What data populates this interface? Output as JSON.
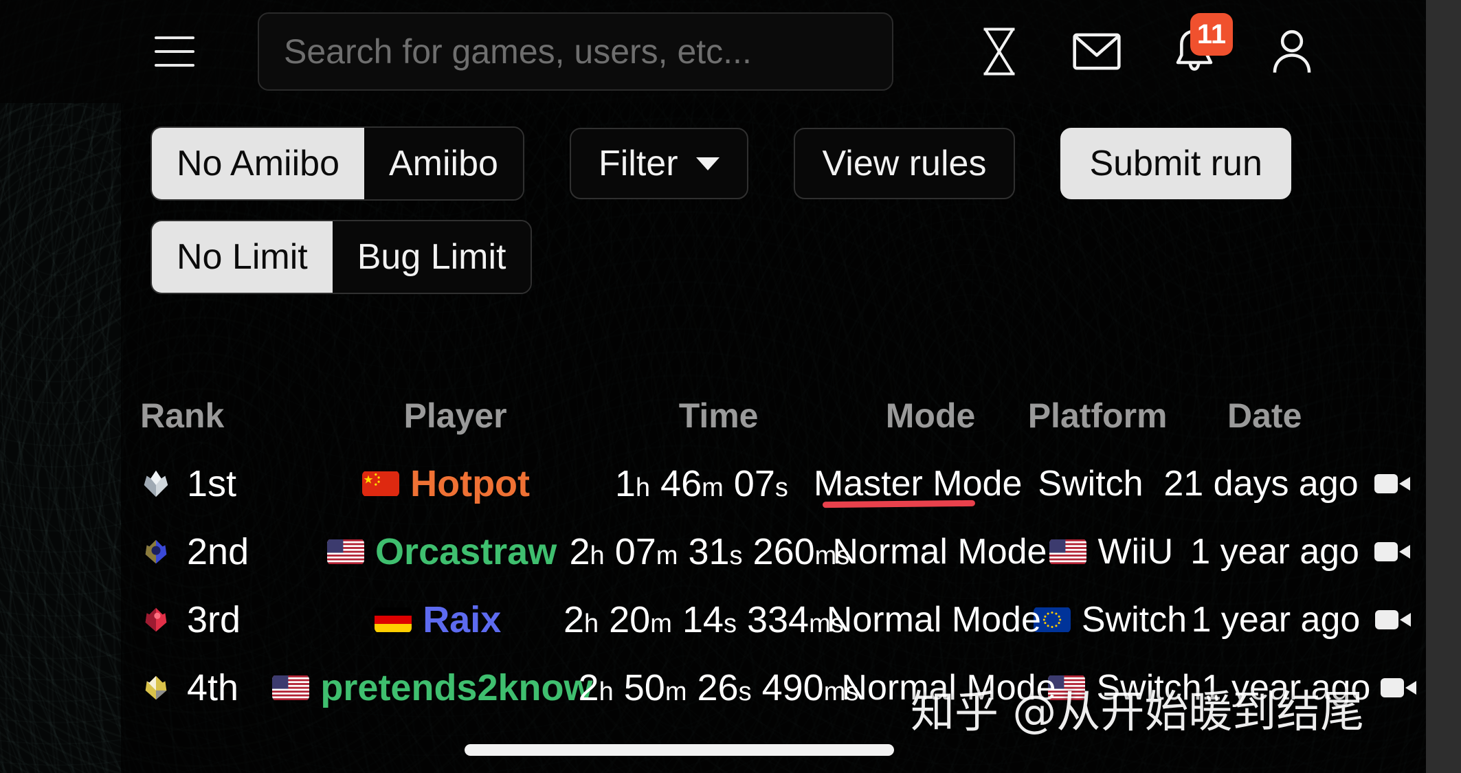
{
  "header": {
    "menu_icon": "hamburger-icon",
    "search": {
      "placeholder": "Search for games, users, etc...",
      "value": ""
    },
    "icons": [
      {
        "name": "hourglass-icon",
        "label": "Pending runs"
      },
      {
        "name": "envelope-icon",
        "label": "Messages"
      },
      {
        "name": "bell-icon",
        "label": "Notifications",
        "badge": "11"
      },
      {
        "name": "user-icon",
        "label": "Account"
      }
    ],
    "badge_color": "#f0512e"
  },
  "toolbar": {
    "amiibo_segment": {
      "options": [
        "No Amiibo",
        "Amiibo"
      ],
      "selected": "No Amiibo"
    },
    "limit_segment": {
      "options": [
        "No Limit",
        "Bug Limit"
      ],
      "selected": "No Limit"
    },
    "filter_label": "Filter",
    "view_rules_label": "View rules",
    "submit_run_label": "Submit run"
  },
  "leaderboard": {
    "columns": [
      "Rank",
      "Player",
      "Time",
      "Mode",
      "Platform",
      "Date"
    ],
    "rows": [
      {
        "rank": "1st",
        "gem": "silver-gem-icon",
        "gem_color": "#cfd6dc",
        "player": "Hotpot",
        "player_color": "#ef7134",
        "flag": "cn",
        "time": {
          "h": "1",
          "m": "46",
          "s": "07",
          "ms": ""
        },
        "time_text": "1h 46m 07s",
        "mode": "Master Mode",
        "platform": "Switch",
        "platform_flag": "",
        "date": "21 days ago",
        "video": "video-icon",
        "annotated": true
      },
      {
        "rank": "2nd",
        "gem": "blue-gem-icon",
        "gem_color": "#3a49d8",
        "player": "Orcastraw",
        "player_color": "#3fbf6f",
        "flag": "us",
        "time": {
          "h": "2",
          "m": "07",
          "s": "31",
          "ms": "260"
        },
        "time_text": "2h 07m 31s 260ms",
        "mode": "Normal Mode",
        "platform": "WiiU",
        "platform_flag": "us",
        "date": "1 year ago",
        "video": "video-icon",
        "annotated": false
      },
      {
        "rank": "3rd",
        "gem": "red-gem-icon",
        "gem_color": "#e23048",
        "player": "Raix",
        "player_color": "#5d6bf0",
        "flag": "de",
        "time": {
          "h": "2",
          "m": "20",
          "s": "14",
          "ms": "334"
        },
        "time_text": "2h 20m 14s 334ms",
        "mode": "Normal Mode",
        "platform": "Switch",
        "platform_flag": "eu",
        "date": "1 year ago",
        "video": "video-icon",
        "annotated": false
      },
      {
        "rank": "4th",
        "gem": "gold-gem-icon",
        "gem_color": "#d9c24a",
        "player": "pretends2know",
        "player_color": "#3fbf6f",
        "flag": "us",
        "time": {
          "h": "2",
          "m": "50",
          "s": "26",
          "ms": "490"
        },
        "time_text": "2h 50m 26s 490ms",
        "mode": "Normal Mode",
        "platform": "Switch",
        "platform_flag": "us",
        "date": "1 year ago",
        "video": "video-icon",
        "annotated": false
      }
    ],
    "annotation_color": "#e8414c"
  },
  "watermark": "知乎 @从开始暖到结尾"
}
